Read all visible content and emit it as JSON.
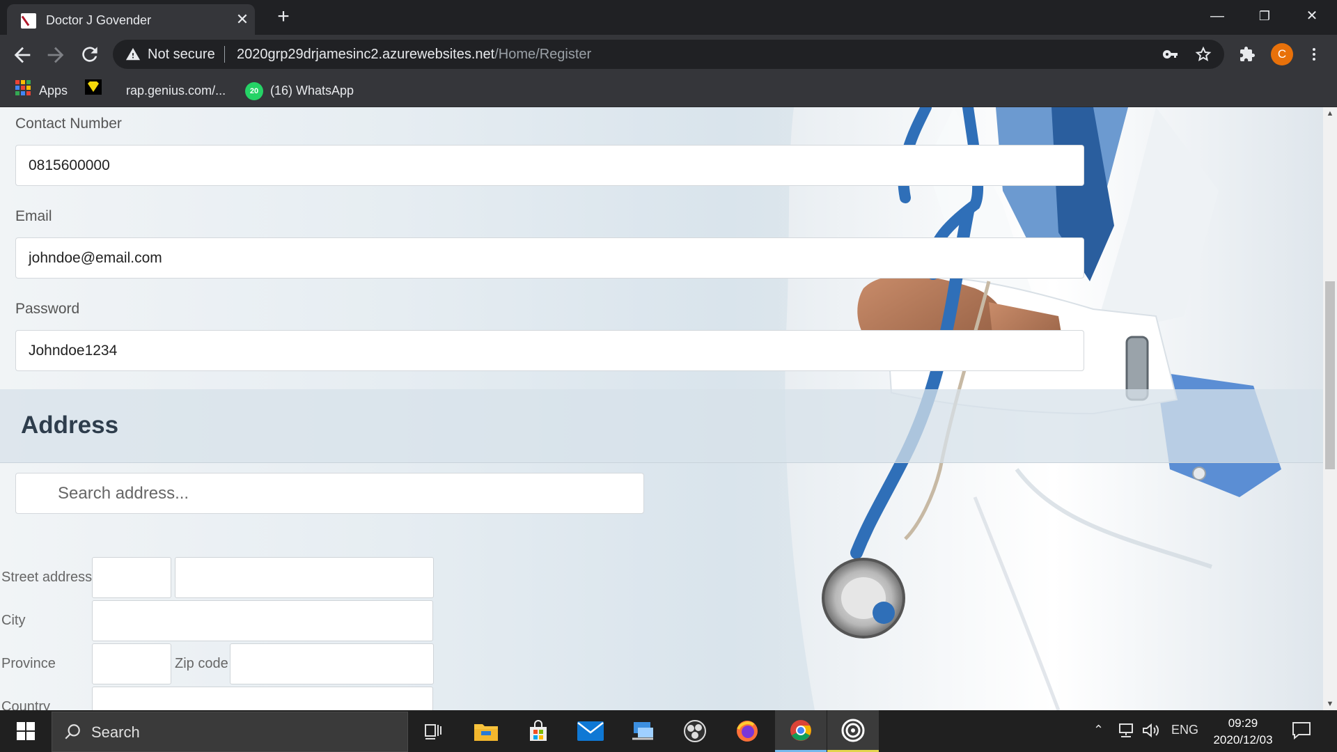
{
  "browser": {
    "tab_title": "Doctor J Govender",
    "tab_close": "✕",
    "new_tab": "+",
    "security_text": "Not secure",
    "url_host": "2020grp29drjamesinc2.azurewebsites.net",
    "url_path": "/Home/Register",
    "profile_initial": "C",
    "window_controls": {
      "minimize": "—",
      "restore": "❐",
      "close": "✕"
    }
  },
  "bookmarks": {
    "apps": "Apps",
    "genius": "rap.genius.com/...",
    "whatsapp": "(16) WhatsApp",
    "whatsapp_badge": "20"
  },
  "form": {
    "contact": {
      "label": "Contact Number",
      "value": "0815600000"
    },
    "email": {
      "label": "Email",
      "value": "johndoe@email.com"
    },
    "password": {
      "label": "Password",
      "value": "Johndoe1234"
    },
    "address_heading": "Address",
    "search_placeholder": "Search address...",
    "street_label": "Street address",
    "city_label": "City",
    "province_label": "Province",
    "zip_label": "Zip code",
    "country_label": "Country"
  },
  "taskbar": {
    "search_text": "Search",
    "language": "ENG",
    "time": "09:29",
    "date": "2020/12/03"
  },
  "colors": {
    "chrome_dark": "#202124",
    "chrome_toolbar": "#35363a",
    "profile_orange": "#e8710a",
    "heading_text": "#2e3d4c",
    "taskbar": "#202020"
  }
}
